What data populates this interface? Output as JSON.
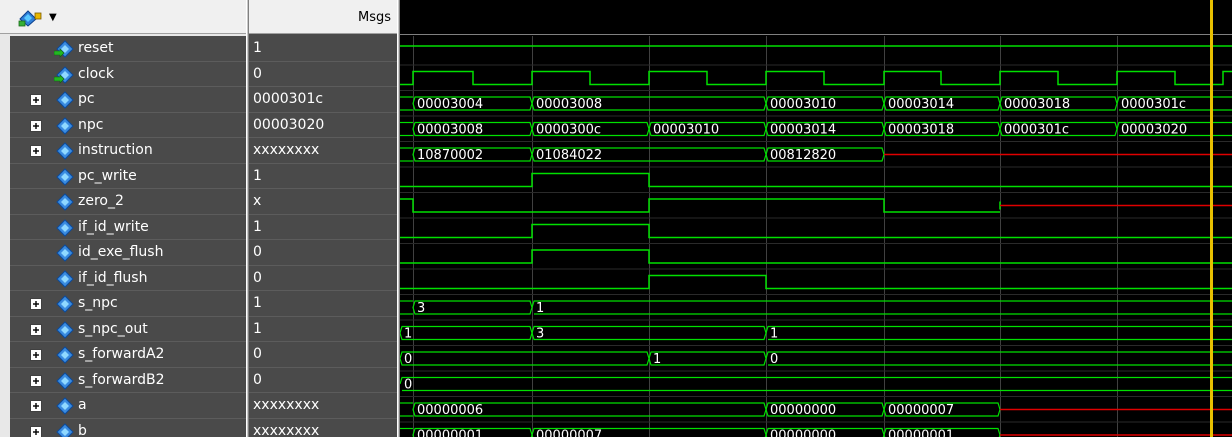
{
  "header": {
    "msgs_label": "Msgs"
  },
  "toolbar": {
    "icon": "wave-group-icon"
  },
  "time": {
    "edges": [
      13,
      73,
      132,
      190,
      249,
      307,
      366,
      424,
      484,
      541,
      600,
      658,
      717,
      775,
      823
    ],
    "cursor": 811
  },
  "colors": {
    "wave_green": "#00e000",
    "wave_red": "#e00000",
    "cursor": "#e8c000",
    "grid": "#404040",
    "bus_text": "#ffffff"
  },
  "signals": [
    {
      "name": "reset",
      "value": "1",
      "expandable": false,
      "icon": "input-port-icon",
      "kind": "bit",
      "levels": [
        [
          0,
          "1"
        ]
      ]
    },
    {
      "name": "clock",
      "value": "0",
      "expandable": false,
      "icon": "input-port-icon",
      "kind": "clock"
    },
    {
      "name": "pc",
      "value": "0000301c",
      "expandable": true,
      "icon": "signal-icon",
      "kind": "bus",
      "segments": [
        [
          13,
          "00003004"
        ],
        [
          132,
          "00003008"
        ],
        [
          366,
          "00003010"
        ],
        [
          484,
          "00003014"
        ],
        [
          600,
          "00003018"
        ],
        [
          717,
          "0000301c"
        ]
      ]
    },
    {
      "name": "npc",
      "value": "00003020",
      "expandable": true,
      "icon": "signal-icon",
      "kind": "bus",
      "segments": [
        [
          13,
          "00003008"
        ],
        [
          132,
          "0000300c"
        ],
        [
          249,
          "00003010"
        ],
        [
          366,
          "00003014"
        ],
        [
          484,
          "00003018"
        ],
        [
          600,
          "0000301c"
        ],
        [
          717,
          "00003020"
        ]
      ]
    },
    {
      "name": "instruction",
      "value": "xxxxxxxx",
      "expandable": true,
      "icon": "signal-icon",
      "kind": "bus",
      "segments": [
        [
          13,
          "10870002"
        ],
        [
          132,
          "01084022"
        ],
        [
          366,
          "00812820"
        ],
        [
          484,
          "X"
        ]
      ]
    },
    {
      "name": "pc_write",
      "value": "1",
      "expandable": false,
      "icon": "signal-icon",
      "kind": "bit",
      "levels": [
        [
          0,
          "0"
        ],
        [
          132,
          "1"
        ],
        [
          249,
          "0"
        ]
      ]
    },
    {
      "name": "zero_2",
      "value": "x",
      "expandable": false,
      "icon": "signal-icon",
      "kind": "bit",
      "levels": [
        [
          0,
          "1"
        ],
        [
          13,
          "0"
        ],
        [
          249,
          "1"
        ],
        [
          484,
          "0"
        ],
        [
          600,
          "X"
        ]
      ]
    },
    {
      "name": "if_id_write",
      "value": "1",
      "expandable": false,
      "icon": "signal-icon",
      "kind": "bit",
      "levels": [
        [
          0,
          "0"
        ],
        [
          132,
          "1"
        ],
        [
          249,
          "0"
        ]
      ]
    },
    {
      "name": "id_exe_flush",
      "value": "0",
      "expandable": false,
      "icon": "signal-icon",
      "kind": "bit",
      "levels": [
        [
          0,
          "0"
        ],
        [
          132,
          "1"
        ],
        [
          249,
          "0"
        ]
      ]
    },
    {
      "name": "if_id_flush",
      "value": "0",
      "expandable": false,
      "icon": "signal-icon",
      "kind": "bit",
      "levels": [
        [
          0,
          "0"
        ],
        [
          249,
          "1"
        ],
        [
          366,
          "0"
        ]
      ]
    },
    {
      "name": "s_npc",
      "value": "1",
      "expandable": true,
      "icon": "signal-icon",
      "kind": "bus",
      "segments": [
        [
          13,
          "3"
        ],
        [
          132,
          "1"
        ]
      ]
    },
    {
      "name": "s_npc_out",
      "value": "1",
      "expandable": true,
      "icon": "signal-icon",
      "kind": "bus",
      "segments": [
        [
          0,
          "1"
        ],
        [
          132,
          "3"
        ],
        [
          366,
          "1"
        ]
      ]
    },
    {
      "name": "s_forwardA2",
      "value": "0",
      "expandable": true,
      "icon": "signal-icon",
      "kind": "bus",
      "segments": [
        [
          0,
          "0"
        ],
        [
          249,
          "1"
        ],
        [
          366,
          "0"
        ]
      ]
    },
    {
      "name": "s_forwardB2",
      "value": "0",
      "expandable": true,
      "icon": "signal-icon",
      "kind": "bus",
      "segments": [
        [
          0,
          "0"
        ]
      ]
    },
    {
      "name": "a",
      "value": "xxxxxxxx",
      "expandable": true,
      "icon": "signal-icon",
      "kind": "bus",
      "segments": [
        [
          13,
          "00000006"
        ],
        [
          366,
          "00000000"
        ],
        [
          484,
          "00000007"
        ],
        [
          600,
          "X"
        ]
      ]
    },
    {
      "name": "b",
      "value": "xxxxxxxx",
      "expandable": true,
      "icon": "signal-icon",
      "kind": "bus",
      "segments": [
        [
          13,
          "00000001"
        ],
        [
          132,
          "00000007"
        ],
        [
          366,
          "00000000"
        ],
        [
          484,
          "00000001"
        ],
        [
          600,
          "X"
        ]
      ]
    }
  ]
}
